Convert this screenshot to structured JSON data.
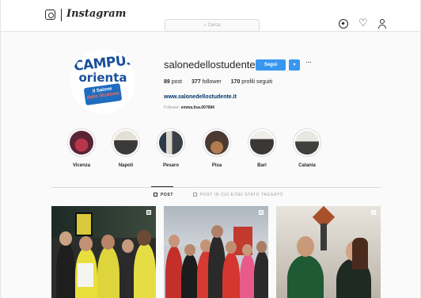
{
  "nav": {
    "wordmark": "Instagram",
    "search_placeholder": "Cerca",
    "icons": [
      "instagram-glyph-icon",
      "compass-icon",
      "heart-icon",
      "user-icon"
    ]
  },
  "profile": {
    "avatar_logo": {
      "line1": "CAMPUS",
      "line2": "orienta",
      "badge_line1": "Il Salone",
      "badge_line2": "dello Studente"
    },
    "username": "salonedellostudente",
    "follow_label": "Segui",
    "dropdown_label": "▾",
    "more_label": "···",
    "stats": {
      "posts_count": "89",
      "posts_label": "post",
      "followers_count": "377",
      "followers_label": "follower",
      "following_count": "170",
      "following_label": "profili seguiti"
    },
    "website": "www.salonedellostudente.it",
    "followed_by_prefix": "Follower:",
    "followed_by_user": "emma.lisa.007684"
  },
  "highlights": [
    {
      "label": "Vicenza"
    },
    {
      "label": "Napoli"
    },
    {
      "label": "Pesaro"
    },
    {
      "label": "Pisa"
    },
    {
      "label": "Bari"
    },
    {
      "label": "Catania"
    }
  ],
  "tabs": {
    "posts": "Post",
    "tagged": "Post in cui è/sei stato taggato"
  },
  "colors": {
    "accent": "#3897f0",
    "brand_blue": "#1a4f9c",
    "brand_red": "#e03c2e"
  }
}
